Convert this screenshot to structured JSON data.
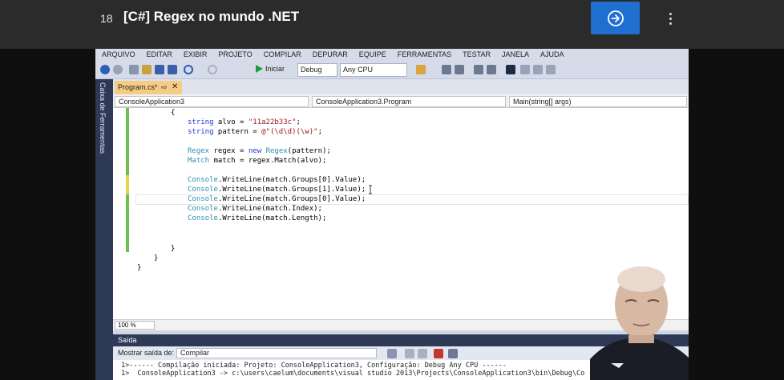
{
  "header": {
    "lesson_number": "18",
    "lesson_title": "[C#] Regex no mundo .NET"
  },
  "vs": {
    "menu": [
      "ARQUIVO",
      "EDITAR",
      "EXIBIR",
      "PROJETO",
      "COMPILAR",
      "DEPURAR",
      "EQUIPE",
      "FERRAMENTAS",
      "TESTAR",
      "JANELA",
      "AJUDA"
    ],
    "toolbar": {
      "start_label": "Iniciar",
      "config": "Debug",
      "platform": "Any CPU"
    },
    "toolbox_label": "Caixa de Ferramentas",
    "tab": {
      "label": "Program.cs*",
      "pin": "⇨",
      "close": "✕"
    },
    "nav": {
      "project": "ConsoleApplication3",
      "class": "ConsoleApplication3.Program",
      "member": "Main(string[] args)"
    },
    "code": {
      "l1": "{",
      "l2a": "string",
      "l2b": " alvo = ",
      "l2c": "\"11a22b33c\"",
      "l2d": ";",
      "l3a": "string",
      "l3b": " pattern = ",
      "l3c": "@\"(\\d\\d)(\\w)\"",
      "l3d": ";",
      "l4a": "Regex",
      "l4b": " regex = ",
      "l4c": "new",
      "l4d": " ",
      "l4e": "Regex",
      "l4f": "(pattern);",
      "l5a": "Match",
      "l5b": " match = regex.Match(alvo);",
      "l6a": "Console",
      "l6b": ".WriteLine(match.Groups[0].Value);",
      "l7a": "Console",
      "l7b": ".WriteLine(match.Groups[1].Value);",
      "l8a": "Console",
      "l8b": ".WriteLine(match.Groups[0].Value);",
      "l9a": "Console",
      "l9b": ".WriteLine(match.Index);",
      "l10a": "Console",
      "l10b": ".WriteLine(match.Length);",
      "c1": "}",
      "c2": "}",
      "c3": "}"
    },
    "zoom": "100 %",
    "output": {
      "title": "Saída",
      "show_label": "Mostrar saída de:",
      "source": "Compilar",
      "line1": "1>------ Compilação iniciada: Projeto: ConsoleApplication3, Configuração: Debug Any CPU ------",
      "line2": "1>  ConsoleApplication3 -> c:\\users\\caelum\\documents\\visual studio 2013\\Projects\\ConsoleApplication3\\bin\\Debug\\Co"
    }
  }
}
